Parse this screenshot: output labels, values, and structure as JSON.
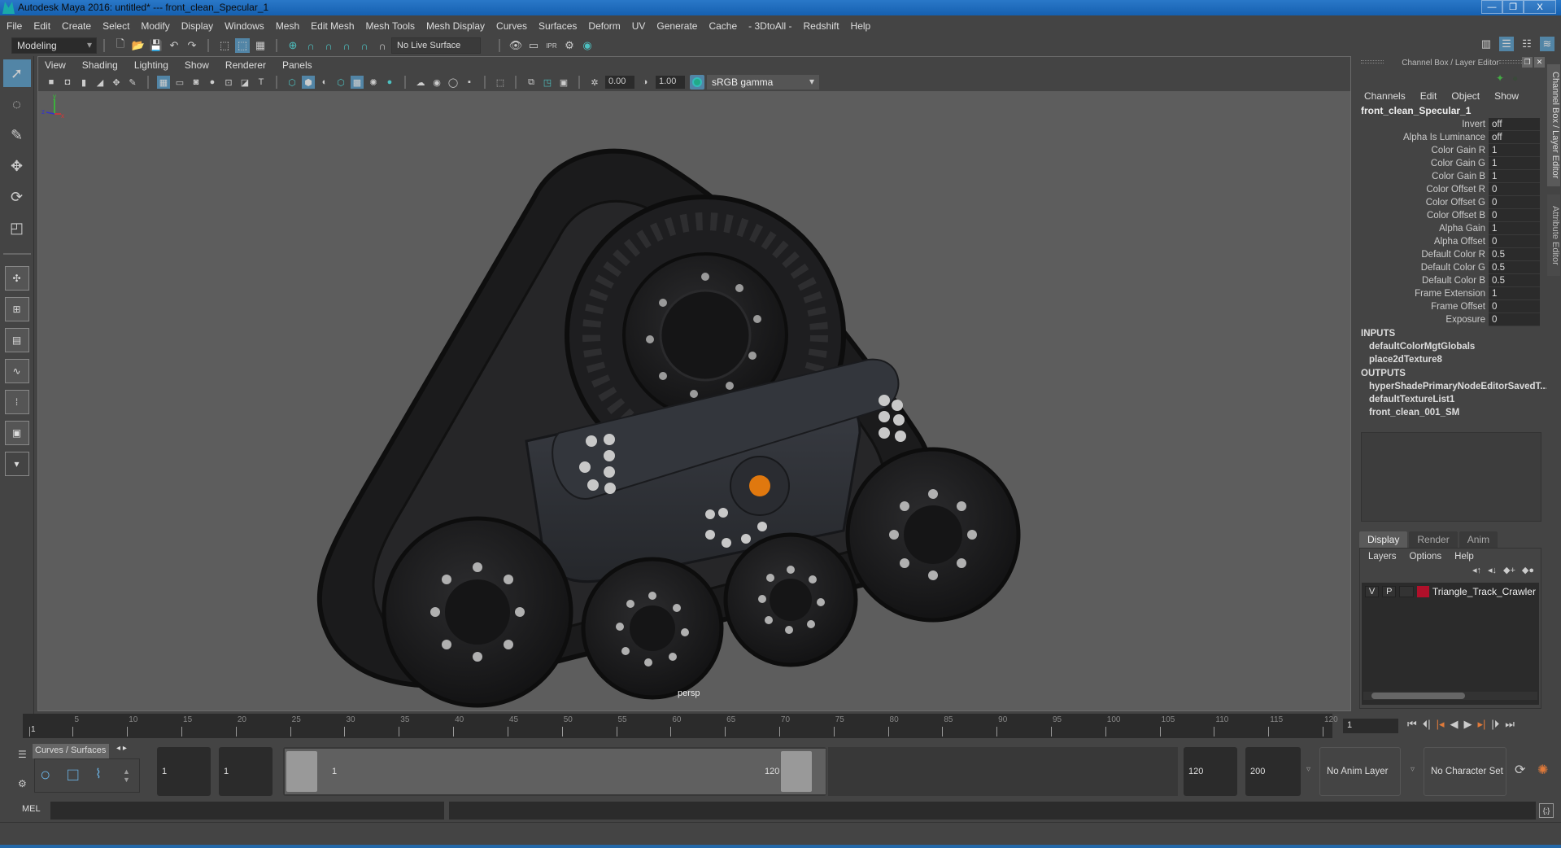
{
  "window": {
    "title": "Autodesk Maya 2016: untitled*   ---   front_clean_Specular_1",
    "minimize_label": "—",
    "restore_label": "❐",
    "close_label": "X"
  },
  "menubar": [
    "File",
    "Edit",
    "Create",
    "Select",
    "Modify",
    "Display",
    "Windows",
    "Mesh",
    "Edit Mesh",
    "Mesh Tools",
    "Mesh Display",
    "Curves",
    "Surfaces",
    "Deform",
    "UV",
    "Generate",
    "Cache",
    "- 3DtoAll -",
    "Redshift",
    "Help"
  ],
  "statusline": {
    "mode": "Modeling",
    "live_surface": "No Live Surface"
  },
  "panel": {
    "menu": [
      "View",
      "Shading",
      "Lighting",
      "Show",
      "Renderer",
      "Panels"
    ],
    "exposure": "0.00",
    "gamma": "1.00",
    "color_space": "sRGB gamma",
    "camera_label": "persp"
  },
  "viewport": {
    "background": "#5d5d5d",
    "accent_orange": "#e0780e",
    "axis": {
      "x": "x",
      "y": "y",
      "z": "z"
    }
  },
  "channel_box": {
    "header": "Channel Box / Layer Editor",
    "menu": [
      "Channels",
      "Edit",
      "Object",
      "Show"
    ],
    "node": "front_clean_Specular_1",
    "attributes": [
      {
        "label": "Invert",
        "value": "off"
      },
      {
        "label": "Alpha Is Luminance",
        "value": "off"
      },
      {
        "label": "Color Gain R",
        "value": "1"
      },
      {
        "label": "Color Gain G",
        "value": "1"
      },
      {
        "label": "Color Gain B",
        "value": "1"
      },
      {
        "label": "Color Offset R",
        "value": "0"
      },
      {
        "label": "Color Offset G",
        "value": "0"
      },
      {
        "label": "Color Offset B",
        "value": "0"
      },
      {
        "label": "Alpha Gain",
        "value": "1"
      },
      {
        "label": "Alpha Offset",
        "value": "0"
      },
      {
        "label": "Default Color R",
        "value": "0.5"
      },
      {
        "label": "Default Color G",
        "value": "0.5"
      },
      {
        "label": "Default Color B",
        "value": "0.5"
      },
      {
        "label": "Frame Extension",
        "value": "1"
      },
      {
        "label": "Frame Offset",
        "value": "0"
      },
      {
        "label": "Exposure",
        "value": "0"
      }
    ],
    "inputs_label": "INPUTS",
    "inputs": [
      "defaultColorMgtGlobals",
      "place2dTexture8"
    ],
    "outputs_label": "OUTPUTS",
    "outputs": [
      "hyperShadePrimaryNodeEditorSavedT...",
      "defaultTextureList1",
      "front_clean_001_SM"
    ]
  },
  "layer_editor": {
    "tabs": [
      "Display",
      "Render",
      "Anim"
    ],
    "active_tab": "Display",
    "menu": [
      "Layers",
      "Options",
      "Help"
    ],
    "layers": [
      {
        "v": "V",
        "p": "P",
        "color": "#b0102a",
        "name": "Triangle_Track_Crawler"
      }
    ]
  },
  "side_tabs": [
    "Channel Box / Layer Editor",
    "Attribute Editor"
  ],
  "time_slider": {
    "ticks": [
      1,
      5,
      10,
      15,
      20,
      25,
      30,
      35,
      40,
      45,
      50,
      55,
      60,
      65,
      70,
      75,
      80,
      85,
      90,
      95,
      100,
      105,
      110,
      115,
      120
    ],
    "range_min": 1,
    "range_max": 120,
    "current_frame": "1"
  },
  "range_slider": {
    "shelf_tab": "Curves / Surfaces",
    "start_time": "1",
    "playback_start": "1",
    "range_start_label": "1",
    "range_end_label": "120",
    "playback_end": "120",
    "end_time": "200",
    "anim_layer": "No Anim Layer",
    "character_set": "No Character Set"
  },
  "command_line": {
    "label": "MEL"
  }
}
